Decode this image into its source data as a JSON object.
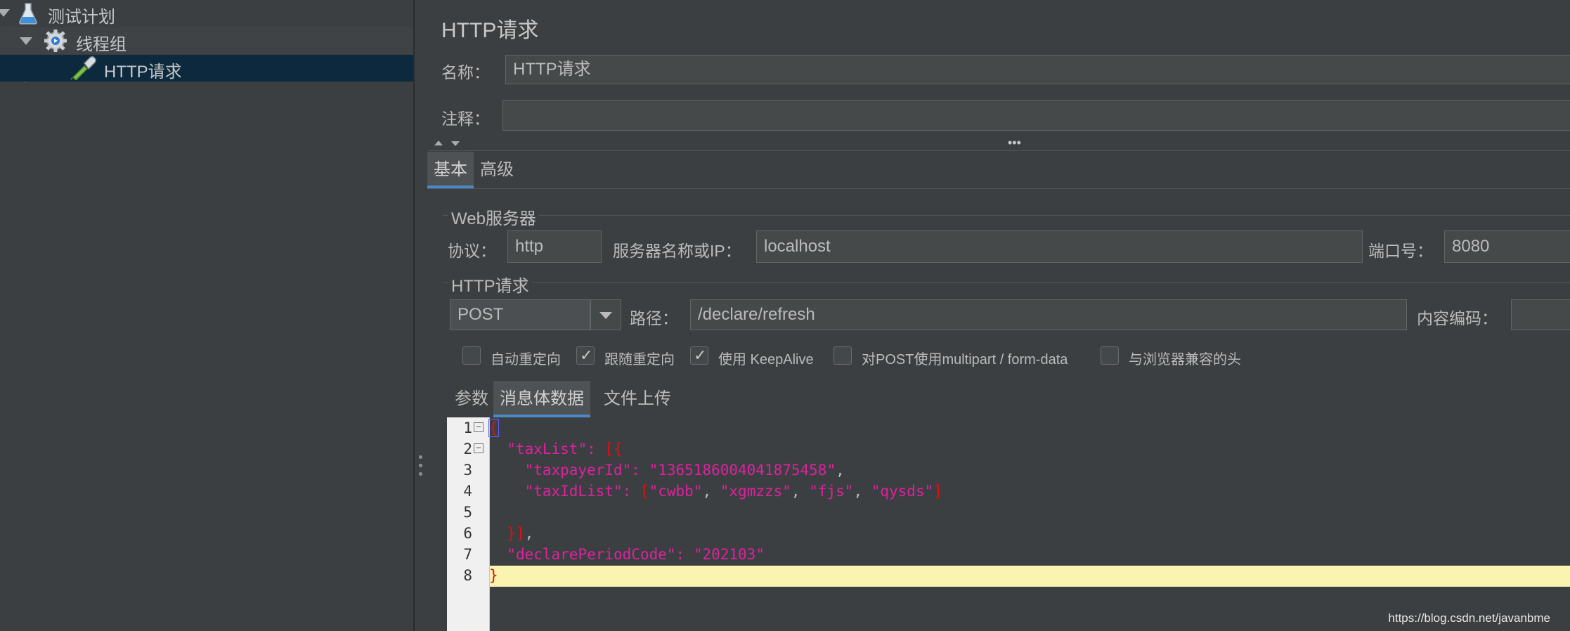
{
  "tree": {
    "items": [
      {
        "label": "测试计划"
      },
      {
        "label": "线程组"
      },
      {
        "label": "HTTP请求"
      }
    ]
  },
  "panel": {
    "title": "HTTP请求",
    "name_label": "名称：",
    "name_value": "HTTP请求",
    "comment_label": "注释：",
    "comment_value": "",
    "tabs": [
      {
        "label": "基本"
      },
      {
        "label": "高级"
      }
    ],
    "web_server": {
      "section_title": "Web服务器",
      "protocol_label": "协议：",
      "protocol_value": "http",
      "server_label": "服务器名称或IP：",
      "server_value": "localhost",
      "port_label": "端口号：",
      "port_value": "8080"
    },
    "http_request": {
      "section_title": "HTTP请求",
      "method_value": "POST",
      "path_label": "路径：",
      "path_value": "/declare/refresh",
      "encoding_label": "内容编码：",
      "encoding_value": ""
    },
    "checkboxes": [
      {
        "label": "自动重定向",
        "checked": false
      },
      {
        "label": "跟随重定向",
        "checked": true
      },
      {
        "label": "使用 KeepAlive",
        "checked": true
      },
      {
        "label": "对POST使用multipart / form-data",
        "checked": false
      },
      {
        "label": "与浏览器兼容的头",
        "checked": false
      }
    ],
    "sub_tabs": [
      {
        "label": "参数"
      },
      {
        "label": "消息体数据"
      },
      {
        "label": "文件上传"
      }
    ],
    "body_lines": [
      "1",
      "2",
      "3",
      "4",
      "5",
      "6",
      "7",
      "8"
    ],
    "body_text": {
      "l1": "{",
      "l2_key": "\"taxList\"",
      "l2_colon": ": ",
      "l2_open": "[{",
      "l3_key": "\"taxpayerId\"",
      "l3_colon": ": ",
      "l3_val": "\"1365186004041875458\"",
      "l3_comma": ",",
      "l4_key": "\"taxIdList\"",
      "l4_colon": ": ",
      "l4_open": "[",
      "l4_v1": "\"cwbb\"",
      "l4_v2": "\"xgmzzs\"",
      "l4_v3": "\"fjs\"",
      "l4_v4": "\"qysds\"",
      "l4_sep": ", ",
      "l4_close": "]",
      "l6_close": "}]",
      "l6_comma": ",",
      "l7_key": "\"declarePeriodCode\"",
      "l7_colon": ": ",
      "l7_val": "\"202103\"",
      "l8": "}"
    }
  },
  "watermark": "https://blog.csdn.net/javanbme"
}
